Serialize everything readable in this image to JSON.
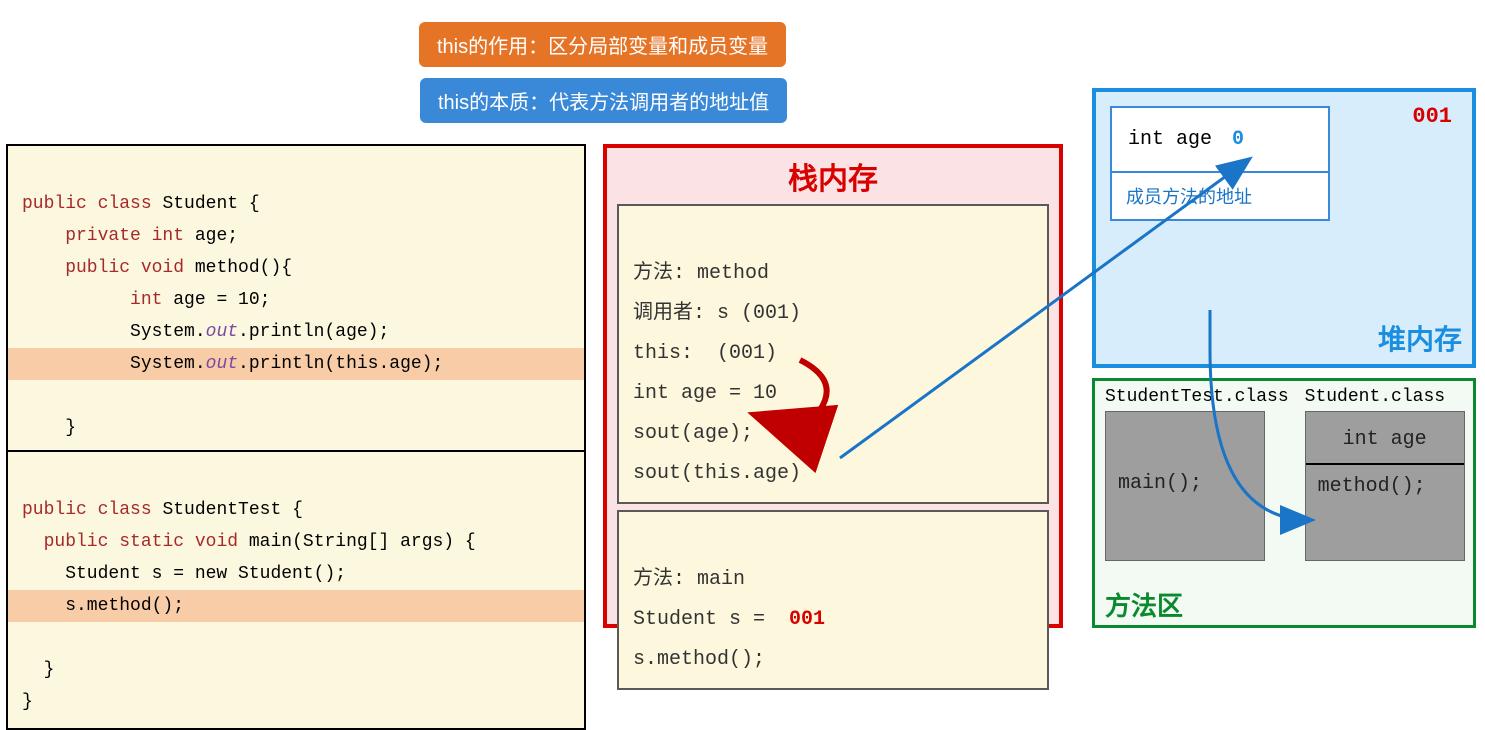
{
  "banners": {
    "orange": "this的作用：区分局部变量和成员变量",
    "blue": "this的本质：代表方法调用者的地址值"
  },
  "code": {
    "student": {
      "l1a": "public",
      "l1b": "class",
      "l1c": " Student {",
      "l2a": "    private",
      "l2b": " int",
      "l2c": " age;",
      "l3a": "    public",
      "l3b": " void",
      "l3c": " method(){",
      "l4a": "          int",
      "l4b": " age = 10;",
      "l5a": "          System.",
      "l5b": "out",
      "l5c": ".println(age);",
      "l6a": "          System.",
      "l6b": "out",
      "l6c": ".println(this.age);",
      "l7": "    }",
      "l8": "}"
    },
    "test": {
      "l1a": "public",
      "l1b": "class",
      "l1c": " StudentTest {",
      "l2a": "  public",
      "l2b": "static",
      "l2c": "void",
      "l2d": " main(String[] args) {",
      "l3": "    Student s = new Student();",
      "l4": "    s.method();",
      "l5": "  }",
      "l6": "}"
    }
  },
  "stack": {
    "title": "栈内存",
    "frame_method": {
      "l1": "方法: method",
      "l2": "调用者: s (001)",
      "l3": "this:  (001)",
      "l4": "int age = 10",
      "l5": "sout(age);",
      "l6": "sout(this.age)"
    },
    "frame_main": {
      "l1": "方法: main",
      "l2a": "Student s = ",
      "l2b": "001",
      "l3": "s.method();"
    }
  },
  "heap": {
    "label": "堆内存",
    "addr": "001",
    "field_name": "int age",
    "field_value": "0",
    "method_label": "成员方法的地址"
  },
  "method_area": {
    "label": "方法区",
    "class1": {
      "name": "StudentTest.class",
      "m1": "main();"
    },
    "class2": {
      "name": "Student.class",
      "f1": "int age",
      "m1": "method();"
    }
  }
}
